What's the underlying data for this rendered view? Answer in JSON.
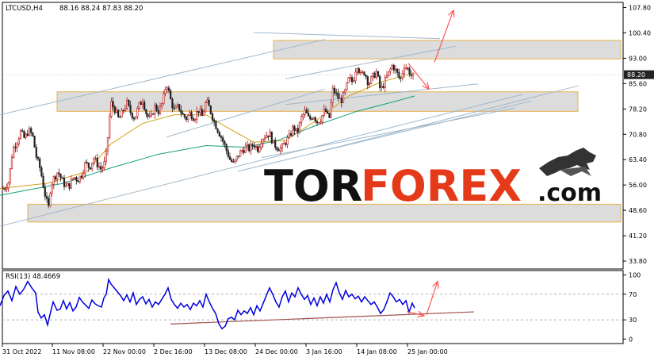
{
  "header": {
    "symbol": "LTCUSD,H4",
    "ohlc": "88.16 88.24 87.83 88.20",
    "rsi_label": "RSI(13) 48.4669"
  },
  "watermark": {
    "part1": "TOR",
    "part2": "FOREX",
    "part3": ".com"
  },
  "colors": {
    "up_candle": "#bb1111",
    "down_candle": "#222222",
    "ma_fast": "#d4a017",
    "ma_slow": "#12a07a",
    "rsi_line": "#0000dd",
    "zone_fill": "#dcdcdc",
    "zone_border": "#e8b04a",
    "channel": "#9fb8cc",
    "arrow": "#ff5555",
    "rsi_trend": "#a0524a",
    "price_tag": "#222222"
  },
  "chart_data": [
    {
      "type": "candlestick",
      "title": "LTCUSD,H4",
      "y_ticks": [
        107.8,
        100.4,
        93.0,
        85.6,
        78.2,
        70.8,
        63.4,
        56.0,
        48.6,
        41.2,
        33.8
      ],
      "y_tick_labels": [
        "107.80",
        "100.40",
        "93.00",
        "85.60",
        "78.20",
        "70.80",
        "63.40",
        "56.00",
        "48.60",
        "41.20",
        "33.80"
      ],
      "ylim": [
        31.5,
        109.3
      ],
      "current_price": "88.20",
      "x_tick_labels": [
        "31 Oct 2022",
        "11 Nov 08:00",
        "22 Nov 00:00",
        "2 Dec 16:00",
        "13 Dec 08:00",
        "24 Dec 00:00",
        "3 Jan 16:00",
        "14 Jan 08:00",
        "25 Jan 00:00"
      ],
      "price_path": [
        [
          0,
          54.5
        ],
        [
          6,
          55.2
        ],
        [
          11,
          57
        ],
        [
          16,
          66.5
        ],
        [
          21,
          68.5
        ],
        [
          26,
          71.5
        ],
        [
          31,
          69.5
        ],
        [
          36,
          72
        ],
        [
          41,
          70.5
        ],
        [
          46,
          64
        ],
        [
          51,
          60.5
        ],
        [
          56,
          54
        ],
        [
          61,
          49
        ],
        [
          64,
          56
        ],
        [
          68,
          58
        ],
        [
          73,
          60
        ],
        [
          78,
          57.5
        ],
        [
          83,
          55.5
        ],
        [
          88,
          56
        ],
        [
          93,
          58.5
        ],
        [
          98,
          57.5
        ],
        [
          103,
          59
        ],
        [
          108,
          62.5
        ],
        [
          113,
          61
        ],
        [
          118,
          64
        ],
        [
          123,
          62
        ],
        [
          128,
          60.5
        ],
        [
          133,
          63
        ],
        [
          136,
          70
        ],
        [
          138,
          75.5
        ],
        [
          140,
          80
        ],
        [
          145,
          78
        ],
        [
          150,
          75
        ],
        [
          155,
          77.5
        ],
        [
          160,
          80
        ],
        [
          165,
          77
        ],
        [
          170,
          75.5
        ],
        [
          175,
          79
        ],
        [
          180,
          81
        ],
        [
          185,
          76.5
        ],
        [
          190,
          75
        ],
        [
          195,
          79
        ],
        [
          200,
          77.5
        ],
        [
          205,
          80
        ],
        [
          210,
          86
        ],
        [
          215,
          81
        ],
        [
          220,
          77.5
        ],
        [
          225,
          79
        ],
        [
          230,
          76.5
        ],
        [
          235,
          75.5
        ],
        [
          240,
          77
        ],
        [
          245,
          75.5
        ],
        [
          250,
          78
        ],
        [
          255,
          76
        ],
        [
          260,
          80.5
        ],
        [
          265,
          78
        ],
        [
          270,
          74.5
        ],
        [
          275,
          72
        ],
        [
          280,
          69.5
        ],
        [
          285,
          66.5
        ],
        [
          290,
          63.5
        ],
        [
          295,
          62
        ],
        [
          300,
          64.5
        ],
        [
          305,
          66
        ],
        [
          310,
          67
        ],
        [
          315,
          66.5
        ],
        [
          320,
          68
        ],
        [
          325,
          66.5
        ],
        [
          330,
          69.5
        ],
        [
          335,
          70.5
        ],
        [
          340,
          71
        ],
        [
          345,
          68
        ],
        [
          350,
          67
        ],
        [
          355,
          66.5
        ],
        [
          360,
          68.5
        ],
        [
          365,
          70
        ],
        [
          370,
          73
        ],
        [
          375,
          71
        ],
        [
          380,
          75.5
        ],
        [
          385,
          77.5
        ],
        [
          390,
          75
        ],
        [
          395,
          76.5
        ],
        [
          400,
          74.5
        ],
        [
          405,
          75.5
        ],
        [
          410,
          78
        ],
        [
          415,
          75
        ],
        [
          420,
          84
        ],
        [
          425,
          82
        ],
        [
          430,
          80.5
        ],
        [
          435,
          83
        ],
        [
          440,
          87
        ],
        [
          445,
          86
        ],
        [
          450,
          91.5
        ],
        [
          455,
          88
        ],
        [
          460,
          89
        ],
        [
          465,
          85.5
        ],
        [
          470,
          87.5
        ],
        [
          475,
          89
        ],
        [
          480,
          83.5
        ],
        [
          485,
          86
        ],
        [
          490,
          88.5
        ],
        [
          495,
          91
        ],
        [
          500,
          89
        ],
        [
          505,
          86.5
        ],
        [
          510,
          91
        ],
        [
          515,
          89.5
        ],
        [
          520,
          87.5
        ],
        [
          523,
          88.2
        ]
      ],
      "ma_fast_path": [
        [
          0,
          55
        ],
        [
          60,
          56.5
        ],
        [
          110,
          60
        ],
        [
          140,
          68
        ],
        [
          180,
          74
        ],
        [
          220,
          76.5
        ],
        [
          260,
          76.5
        ],
        [
          285,
          73
        ],
        [
          320,
          68.5
        ],
        [
          360,
          69
        ],
        [
          400,
          75
        ],
        [
          440,
          82
        ],
        [
          480,
          86
        ],
        [
          510,
          88
        ],
        [
          523,
          88.5
        ]
      ],
      "ma_slow_path": [
        [
          0,
          53
        ],
        [
          80,
          56.5
        ],
        [
          140,
          61
        ],
        [
          200,
          65
        ],
        [
          260,
          67.5
        ],
        [
          310,
          67
        ],
        [
          350,
          69
        ],
        [
          400,
          73.5
        ],
        [
          450,
          77.5
        ],
        [
          500,
          80.5
        ],
        [
          523,
          82
        ]
      ],
      "zones": [
        {
          "x1": 345,
          "x2": 783,
          "y1": 92.8,
          "y2": 98.2
        },
        {
          "x1": 72,
          "x2": 729,
          "y1": 77.5,
          "y2": 83.2
        },
        {
          "x1": 35,
          "x2": 783,
          "y1": 45.2,
          "y2": 50.4
        }
      ],
      "channel_lines": [
        [
          [
            0,
            76.5
          ],
          [
            410,
            98.5
          ]
        ],
        [
          [
            320,
            100.5
          ],
          [
            555,
            98.7
          ]
        ],
        [
          [
            360,
            87
          ],
          [
            575,
            96.5
          ]
        ],
        [
          [
            360,
            79.5
          ],
          [
            603,
            85.5
          ]
        ],
        [
          [
            0,
            44
          ],
          [
            660,
            82.5
          ]
        ],
        [
          [
            300,
            60
          ],
          [
            670,
            80.5
          ]
        ],
        [
          [
            390,
            65
          ],
          [
            730,
            85
          ]
        ],
        [
          [
            330,
            64
          ],
          [
            650,
            78.5
          ]
        ],
        [
          [
            210,
            70
          ],
          [
            410,
            84
          ]
        ]
      ],
      "arrows": [
        [
          [
            515,
            91.5
          ],
          [
            541,
            84
          ]
        ],
        [
          [
            548,
            91.8
          ],
          [
            572,
            107
          ]
        ]
      ]
    },
    {
      "type": "line",
      "title": "RSI(13) 48.4669",
      "y_ticks": [
        100,
        70,
        30,
        0
      ],
      "y_tick_labels": [
        "100",
        "70",
        "30",
        "0"
      ],
      "levels": [
        70,
        30
      ],
      "ylim": [
        -7,
        107
      ],
      "rsi_path": [
        [
          0,
          52
        ],
        [
          5,
          68
        ],
        [
          10,
          75
        ],
        [
          15,
          60
        ],
        [
          20,
          82
        ],
        [
          25,
          70
        ],
        [
          30,
          78
        ],
        [
          35,
          90
        ],
        [
          40,
          80
        ],
        [
          45,
          72
        ],
        [
          48,
          42
        ],
        [
          52,
          33
        ],
        [
          56,
          38
        ],
        [
          60,
          22
        ],
        [
          63,
          38
        ],
        [
          67,
          58
        ],
        [
          72,
          45
        ],
        [
          76,
          47
        ],
        [
          80,
          60
        ],
        [
          84,
          47
        ],
        [
          88,
          57
        ],
        [
          92,
          44
        ],
        [
          96,
          50
        ],
        [
          100,
          65
        ],
        [
          104,
          58
        ],
        [
          108,
          53
        ],
        [
          112,
          48
        ],
        [
          116,
          61
        ],
        [
          120,
          55
        ],
        [
          124,
          52
        ],
        [
          128,
          50
        ],
        [
          131,
          64
        ],
        [
          134,
          70
        ],
        [
          137,
          93
        ],
        [
          140,
          86
        ],
        [
          144,
          80
        ],
        [
          148,
          74
        ],
        [
          152,
          68
        ],
        [
          156,
          60
        ],
        [
          160,
          69
        ],
        [
          164,
          58
        ],
        [
          168,
          72
        ],
        [
          172,
          54
        ],
        [
          176,
          62
        ],
        [
          180,
          66
        ],
        [
          184,
          55
        ],
        [
          188,
          62
        ],
        [
          192,
          50
        ],
        [
          196,
          58
        ],
        [
          200,
          54
        ],
        [
          204,
          62
        ],
        [
          208,
          70
        ],
        [
          212,
          80
        ],
        [
          216,
          62
        ],
        [
          220,
          54
        ],
        [
          224,
          48
        ],
        [
          228,
          56
        ],
        [
          232,
          50
        ],
        [
          236,
          54
        ],
        [
          240,
          46
        ],
        [
          244,
          56
        ],
        [
          248,
          52
        ],
        [
          252,
          60
        ],
        [
          256,
          50
        ],
        [
          260,
          70
        ],
        [
          264,
          58
        ],
        [
          268,
          48
        ],
        [
          272,
          40
        ],
        [
          276,
          24
        ],
        [
          280,
          16
        ],
        [
          284,
          20
        ],
        [
          288,
          32
        ],
        [
          292,
          34
        ],
        [
          296,
          30
        ],
        [
          300,
          45
        ],
        [
          304,
          38
        ],
        [
          308,
          44
        ],
        [
          312,
          40
        ],
        [
          316,
          49
        ],
        [
          320,
          38
        ],
        [
          324,
          52
        ],
        [
          328,
          44
        ],
        [
          332,
          56
        ],
        [
          336,
          68
        ],
        [
          340,
          80
        ],
        [
          344,
          70
        ],
        [
          348,
          58
        ],
        [
          352,
          50
        ],
        [
          356,
          66
        ],
        [
          360,
          75
        ],
        [
          364,
          58
        ],
        [
          368,
          72
        ],
        [
          372,
          66
        ],
        [
          376,
          80
        ],
        [
          380,
          70
        ],
        [
          384,
          62
        ],
        [
          388,
          68
        ],
        [
          392,
          54
        ],
        [
          396,
          64
        ],
        [
          400,
          52
        ],
        [
          404,
          66
        ],
        [
          408,
          56
        ],
        [
          412,
          70
        ],
        [
          416,
          58
        ],
        [
          420,
          77
        ],
        [
          424,
          88
        ],
        [
          428,
          72
        ],
        [
          432,
          62
        ],
        [
          436,
          76
        ],
        [
          440,
          66
        ],
        [
          444,
          70
        ],
        [
          448,
          63
        ],
        [
          452,
          67
        ],
        [
          456,
          58
        ],
        [
          460,
          66
        ],
        [
          464,
          60
        ],
        [
          468,
          54
        ],
        [
          472,
          58
        ],
        [
          476,
          50
        ],
        [
          480,
          40
        ],
        [
          484,
          46
        ],
        [
          488,
          58
        ],
        [
          492,
          72
        ],
        [
          496,
          66
        ],
        [
          500,
          58
        ],
        [
          504,
          62
        ],
        [
          508,
          54
        ],
        [
          512,
          60
        ],
        [
          516,
          42
        ],
        [
          520,
          56
        ],
        [
          523,
          48.5
        ]
      ],
      "trend_line": [
        [
          215,
          23.5
        ],
        [
          598,
          42.5
        ]
      ],
      "arrows": [
        [
          [
            513,
            43
          ],
          [
            535,
            36.5
          ]
        ],
        [
          [
            538,
            38
          ],
          [
            552,
            90
          ]
        ]
      ]
    }
  ]
}
